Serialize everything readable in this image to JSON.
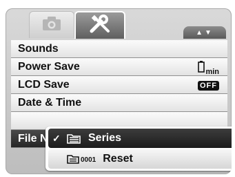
{
  "tabs": [
    {
      "icon": "camera-icon",
      "active": false
    },
    {
      "icon": "wrench-screwdriver-icon",
      "active": true
    }
  ],
  "scroll_indicator": "▲▼",
  "menu": {
    "items": [
      {
        "label": "Sounds"
      },
      {
        "label": "Power Save",
        "value_text": "min",
        "value_icon": "battery-icon"
      },
      {
        "label": "LCD Save",
        "value_text": "OFF"
      },
      {
        "label": "Date & Time"
      },
      {
        "label": ""
      },
      {
        "label": "File Numbering"
      }
    ]
  },
  "popup": {
    "items": [
      {
        "label": "Series",
        "checked": true,
        "icon": "series-folder-icon"
      },
      {
        "label": "Reset",
        "checked": false,
        "icon": "reset-folder-icon",
        "code": "0001"
      }
    ],
    "check_mark": "✓"
  }
}
